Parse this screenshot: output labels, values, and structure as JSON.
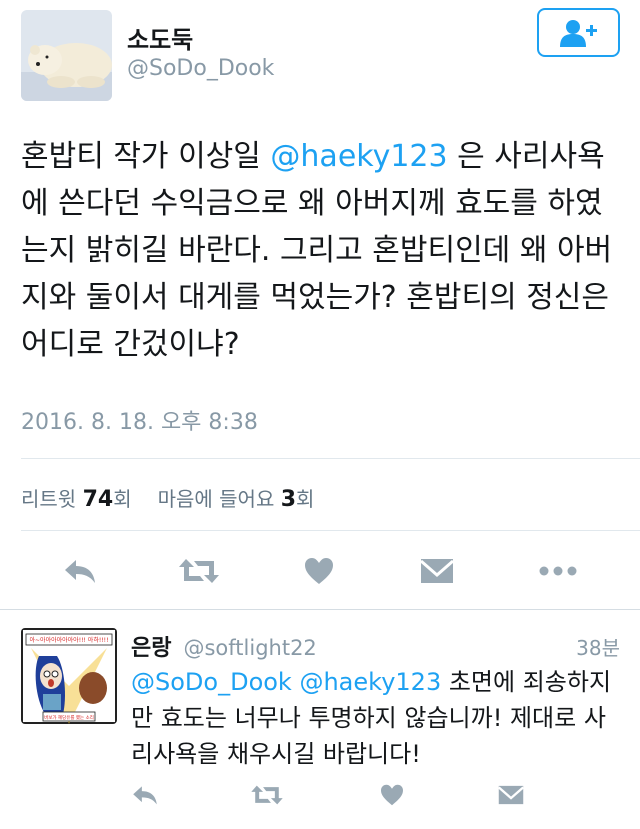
{
  "tweet": {
    "name": "소도둑",
    "handle": "@SoDo_Dook",
    "follow_icon": "add-user-icon",
    "text_before": "혼밥티 작가 이상일 ",
    "mention": "@haeky123",
    "text_after": " 은 사리사욕에 쓴다던 수익금으로 왜 아버지께 효도를 하였는지 밝히길 바란다. 그리고 혼밥티인데 왜 아버지와 둘이서 대게를 먹었는가? 혼밥티의 정신은 어디로 간겄이냐?",
    "timestamp": "2016. 8. 18. 오후 8:38",
    "stats": {
      "retweet_label": "리트윗",
      "retweet_count": "74",
      "retweet_unit": "회",
      "like_label": "마음에 들어요",
      "like_count": "3",
      "like_unit": "회"
    },
    "actions": [
      "reply-icon",
      "retweet-icon",
      "heart-icon",
      "message-icon",
      "more-icon"
    ]
  },
  "reply": {
    "name": "은랑",
    "handle": "@softlight22",
    "time": "38분",
    "mention1": "@SoDo_Dook",
    "mention2": "@haeky123",
    "text": " 초면에 죄송하지만 효도는 너무나 투명하지 않습니까! 제대로 사리사욕을 채우시길 바랍니다!",
    "avatar_caption_top": "아~아아아아아아아!!! 아하!!!!",
    "avatar_caption_bottom": "버보가 혜당유를 했는 소리",
    "actions": [
      "reply-icon",
      "retweet-icon",
      "heart-icon",
      "message-icon"
    ]
  },
  "colors": {
    "accent": "#1da1f2",
    "muted": "#8899a6",
    "icon": "#9aa9b4"
  }
}
